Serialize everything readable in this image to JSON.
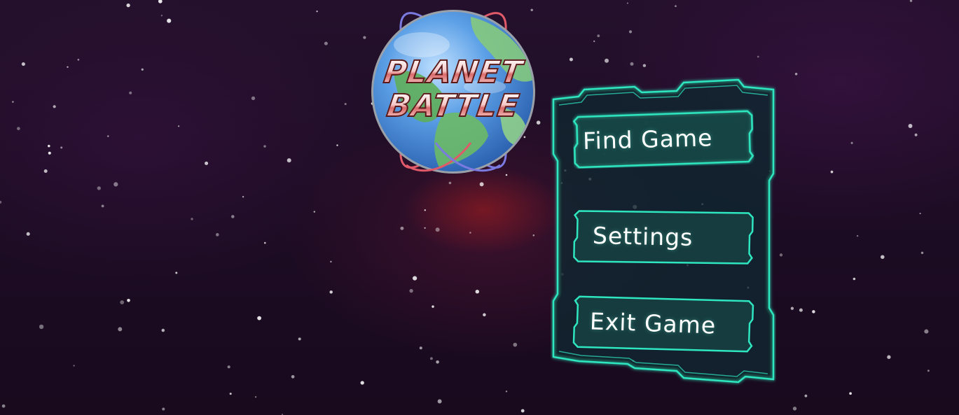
{
  "game": {
    "title_line1": "PLANET",
    "title_line2": "BATTLE"
  },
  "menu": {
    "find_game_label": "Find Game",
    "settings_label": "Settings",
    "exit_game_label": "Exit Game"
  },
  "colors": {
    "accent": "#2ee6c0",
    "background": "#1d0c24",
    "nebula_red": "#aa1e1e",
    "planet_ocean": "#4a8fd8",
    "planet_land": "#5fae5a",
    "orbit_red": "#e05a6a",
    "orbit_blue": "#7a7ae0"
  },
  "icons": {
    "logo": "planet-battle-logo",
    "background": "starfield"
  }
}
